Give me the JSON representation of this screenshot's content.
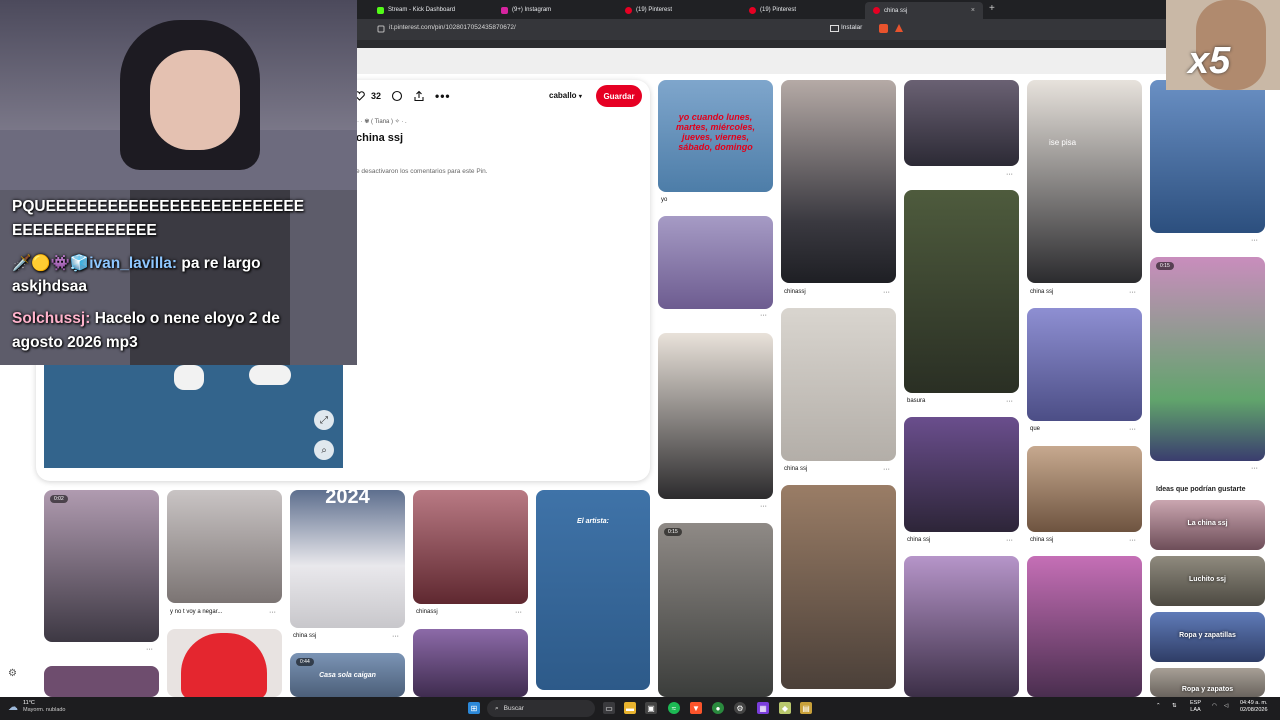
{
  "browser": {
    "tabs": [
      {
        "label": "Stream - Kick Dashboard",
        "fav_color": "#53fc18"
      },
      {
        "label": "(9+) Instagram",
        "fav_color": "#d6249f"
      },
      {
        "label": "(19) Pinterest",
        "fav_color": "#e60023"
      },
      {
        "label": "(19) Pinterest",
        "fav_color": "#e60023"
      },
      {
        "label": "china ssj",
        "fav_color": "#e60023",
        "active": true
      }
    ],
    "new_tab": "+",
    "close_tab": "×",
    "url": "it.pinterest.com/pin/1028017052435870672/",
    "install_label": "Instalar"
  },
  "pin": {
    "reactions": "32",
    "board": "caballo",
    "save_label": "Guardar",
    "author": "· · ✾ ( Tiana ) ✧ · .",
    "title": "china ssj",
    "comments_note": "e desactivaron los comentarios para este Pin."
  },
  "grid": {
    "col1_caption": "yo",
    "col1_tile1_text": "yo cuando lunes, martes, miércoles, jueves, viernes, sábado, domingo",
    "col2_caption_a": "chinassj",
    "col2_caption_b": "china ssj",
    "col3_caption_a": "basura",
    "col3_caption_b": "china ssj",
    "col4_overlay": "ise pisa",
    "col4_caption_a": "china ssj",
    "col4_caption_b": "que",
    "col4_caption_c": "china ssj",
    "col5_badge": "0:15",
    "ideas_title": "Ideas que podrían gustarte",
    "ideas": [
      "La china ssj",
      "Luchito ssj",
      "Ropa y zapatillas",
      "Ropa y zapatos"
    ],
    "bottom_captions": [
      "y no t voy a negar...",
      "china ssj",
      "chinassj"
    ],
    "bottom_badge_1": "0:02",
    "bottom_badge_2": "0:44",
    "bottom_badge_3": "0:15",
    "bottom_overlay_year": "2024",
    "bottom_overlay_artist": "El artista:",
    "bottom_overlay_casa": "Casa sola caigan"
  },
  "chat": {
    "line1": "PQUEEEEEEEEEEEEEEEEEEEEEEEEE",
    "line2": "EEEEEEEEEEEEEE",
    "badges": "🗡️🟡👾🧊",
    "user1": "ivan_lavilla:",
    "msg1": " pa re largo",
    "msg1b": "askjhdsaa",
    "user2": "Solchussj:",
    "msg2": " Hacelo o nene eloyo 2 de",
    "msg2b": "agosto 2026 mp3"
  },
  "overlay": {
    "multiplier": "x5"
  },
  "taskbar": {
    "temp": "11°C",
    "weather": "Mayorm. nublado",
    "search": "Buscar",
    "lang1": "ESP",
    "lang2": "LAA",
    "time": "04:49 a. m.",
    "date": "02/08/2026"
  }
}
